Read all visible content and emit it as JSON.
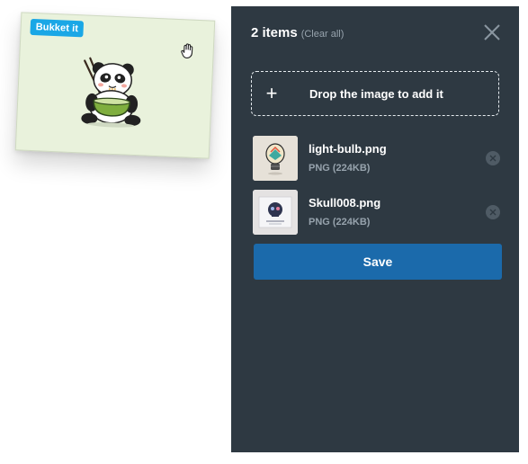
{
  "drag_card": {
    "badge": "Bukket it",
    "illustration": "panda-eating-noodles",
    "cursor_icon": "grab-hand-icon",
    "background": "#e9f2dc",
    "badge_color": "#1aa7e6"
  },
  "panel": {
    "item_count_label": "2 items",
    "clear_all_label": "(Clear all)",
    "close_icon": "close-icon",
    "dropzone": {
      "icon": "plus-icon",
      "label": "Drop the image to add it"
    },
    "items": [
      {
        "name": "light-bulb.png",
        "meta": "PNG (224KB)",
        "thumbnail": "light-bulb-illustration"
      },
      {
        "name": "Skull008.png",
        "meta": "PNG (224KB)",
        "thumbnail": "skull-poster-illustration"
      }
    ],
    "save_label": "Save",
    "colors": {
      "panel_bg": "#2e3942",
      "accent": "#1b6aab",
      "muted_text": "#97a3ad"
    }
  }
}
